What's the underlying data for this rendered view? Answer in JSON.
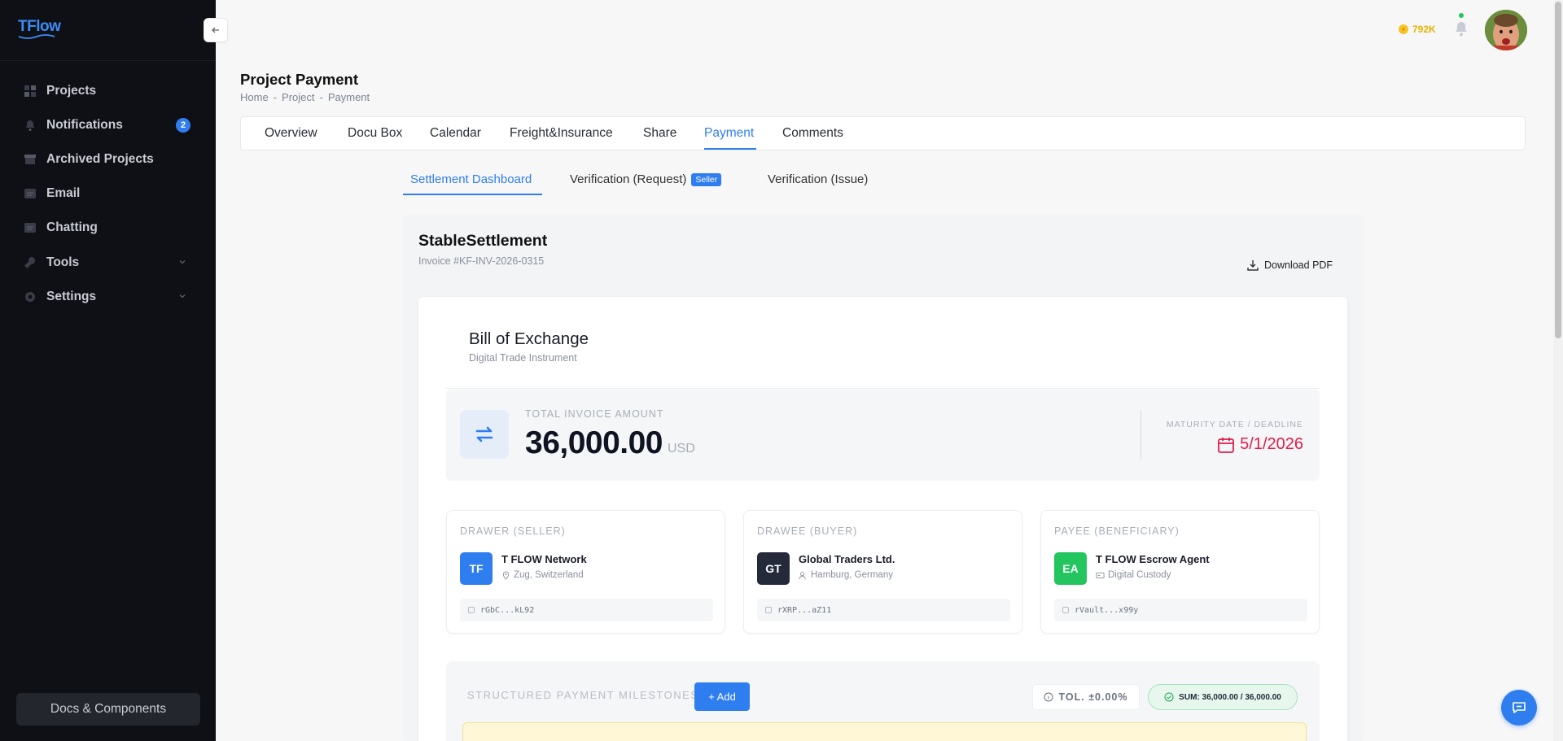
{
  "sidebar": {
    "logo": "TFlow",
    "items": [
      {
        "label": "Projects"
      },
      {
        "label": "Notifications",
        "badge": "2"
      },
      {
        "label": "Archived Projects"
      },
      {
        "label": "Email"
      },
      {
        "label": "Chatting"
      },
      {
        "label": "Tools"
      },
      {
        "label": "Settings"
      }
    ],
    "docs_button": "Docs & Components"
  },
  "topbar": {
    "coins": "792K"
  },
  "header": {
    "title": "Project Payment",
    "breadcrumb": [
      "Home",
      "-",
      "Project",
      "-",
      "Payment"
    ]
  },
  "tabs": [
    {
      "label": "Overview"
    },
    {
      "label": "Docu Box"
    },
    {
      "label": "Calendar"
    },
    {
      "label": "Freight&Insurance"
    },
    {
      "label": "Share"
    },
    {
      "label": "Payment",
      "active": true
    },
    {
      "label": "Comments"
    }
  ],
  "subtabs": [
    {
      "label": "Settlement Dashboard",
      "active": true
    },
    {
      "label": "Verification (Request)",
      "badge": "Seller"
    },
    {
      "label": "Verification (Issue)"
    }
  ],
  "dashboard": {
    "title": "StableSettlement",
    "invoice": "Invoice #KF-INV-2026-0315",
    "download": "Download PDF",
    "instrument": {
      "title": "Bill of Exchange",
      "subtitle": "Digital Trade Instrument"
    },
    "amount": {
      "label": "TOTAL INVOICE AMOUNT",
      "value": "36,000.00",
      "currency": "USD",
      "maturity_label": "MATURITY DATE / DEADLINE",
      "maturity_value": "5/1/2026"
    },
    "parties": [
      {
        "role": "DRAWER (SELLER)",
        "initials": "TF",
        "name": "T FLOW Network",
        "location": "Zug, Switzerland",
        "address": "rGbC...kL92",
        "color": "#2f7ef0",
        "loc_icon": "map-pin-icon"
      },
      {
        "role": "DRAWEE (BUYER)",
        "initials": "GT",
        "name": "Global Traders Ltd.",
        "location": "Hamburg, Germany",
        "address": "rXRP...aZ11",
        "color": "#252a3a",
        "loc_icon": "user-icon"
      },
      {
        "role": "PAYEE (BENEFICIARY)",
        "initials": "EA",
        "name": "T FLOW Escrow Agent",
        "location": "Digital Custody",
        "address": "rVault...x99y",
        "color": "#22c55e",
        "loc_icon": "id-card-icon"
      }
    ],
    "milestones": {
      "label": "STRUCTURED PAYMENT MILESTONES",
      "add": "+ Add",
      "tolerance": "TOL. ±0.00%",
      "sum": "SUM: 36,000.00 / 36,000.00"
    }
  }
}
